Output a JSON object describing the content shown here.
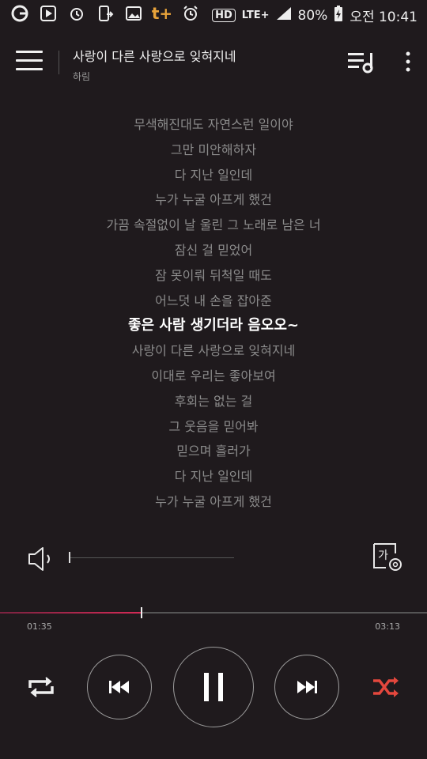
{
  "status": {
    "battery": "80%",
    "time": "오전 10:41",
    "network": "LTE+",
    "hd": "HD",
    "carrier_icon_text": "t+",
    "icons": [
      "app-circle-icon",
      "play-store-icon",
      "alarm-icon",
      "phone-transfer-icon",
      "gallery-icon",
      "t-plus-icon",
      "alarm-clock-icon",
      "hd-voice-icon",
      "lte-icon",
      "signal-icon",
      "battery-charging-icon"
    ]
  },
  "header": {
    "title": "사랑이 다른 사랑으로 잊혀지네",
    "artist": "하림",
    "icons": [
      "menu-icon",
      "playlist-icon",
      "more-icon"
    ]
  },
  "lyrics": [
    "무색해진대도 자연스런 일이야",
    "그만 미안해하자",
    "다 지난 일인데",
    "누가 누굴 아프게 했건",
    "가끔 속절없이 날 울린 그 노래로 남은 너",
    "잠신 걸 믿었어",
    "잠 못이뤄 뒤척일 때도",
    "어느덧 내 손을 잡아준",
    "좋은 사람 생기더라 음오오~",
    "사랑이 다른 사랑으로 잊혀지네",
    "이대로 우리는 좋아보여",
    "후회는 없는 걸",
    "그 웃음을 믿어봐",
    "믿으며 흘러가",
    "다 지난 일인데",
    "누가 누굴 아프게 했건"
  ],
  "active_lyric_index": 8,
  "player": {
    "current_time": "01:35",
    "total_time": "03:13",
    "progress_fraction": 0.33,
    "volume_fraction": 0.0,
    "font_size_label": "가",
    "accent_color": "#d42a56",
    "shuffle_color": "#e4473d"
  }
}
